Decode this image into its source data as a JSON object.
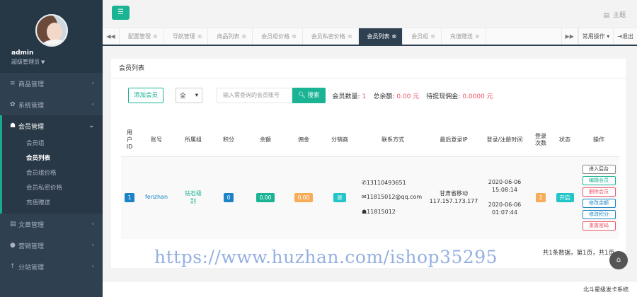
{
  "user": {
    "name": "admin",
    "role": "超级管理员"
  },
  "sidebar": {
    "items": [
      {
        "label": "商品管理",
        "icon": "list-icon"
      },
      {
        "label": "系统管理",
        "icon": "gear-icon"
      },
      {
        "label": "会员管理",
        "icon": "users-icon"
      },
      {
        "label": "文章管理",
        "icon": "file-icon"
      },
      {
        "label": "营销管理",
        "icon": "tag-icon"
      },
      {
        "label": "分站管理",
        "icon": "branch-icon"
      }
    ],
    "member_sub": [
      "会员组",
      "会员列表",
      "会员组价格",
      "会员私密价格",
      "充值赠送"
    ]
  },
  "topbar": {
    "theme_label": "主题"
  },
  "tabs": {
    "items": [
      "配置管理",
      "导航管理",
      "商品列表",
      "会员组价格",
      "会员私密价格",
      "会员列表",
      "会员组",
      "充值赠送"
    ],
    "active": "会员列表",
    "ops_label": "常用操作",
    "logout_label": "退出"
  },
  "panel": {
    "title": "会员列表",
    "add_button": "添加会员",
    "select_value": "全",
    "search_placeholder": "输入需查询的会员账号",
    "search_button": "搜索",
    "stats": {
      "count_label": "会员数量:",
      "count_value": "1",
      "balance_label": "总余额:",
      "balance_value": "0.00 元",
      "commission_label": "待提现佣金:",
      "commission_value": "0.0000 元"
    }
  },
  "table": {
    "headers": {
      "id": [
        "用",
        "户",
        "ID"
      ],
      "account": "账号",
      "group": "所属组",
      "points": "积分",
      "balance": "余额",
      "commission": "佣金",
      "distributor": "分销商",
      "contact": "联系方式",
      "last_ip": "最后登录IP",
      "time": "登录/注册时间",
      "login_count": [
        "登录",
        "次数"
      ],
      "status": "状态",
      "actions": "操作"
    },
    "row": {
      "id": "1",
      "account": "fenzhan",
      "group": [
        "钻石级",
        "别"
      ],
      "points": "0",
      "balance": "0.00",
      "commission": "0.00",
      "distributor": "是",
      "phone": "13110493651",
      "email": "11815012@qq.com",
      "qq": "11815012",
      "ip_location": "甘肃省移动",
      "ip": "117.157.173.177",
      "login_date": "2020-06-06",
      "login_time": "15:08:14",
      "reg_date": "2020-06-06",
      "reg_time": "01:07:44",
      "login_count": "2",
      "status": "开启",
      "ops": [
        "进入后台",
        "编辑会员",
        "删除会员",
        "修改余额",
        "修改积分",
        "重置密码"
      ]
    }
  },
  "pager": {
    "text": "共1条数据，第1页，共1页"
  },
  "watermark": "https://www.huzhan.com/ishop35295",
  "footer": {
    "text": "北斗星级发卡系统"
  },
  "colors": {
    "sidebar": "#2f4050",
    "accent": "#1ab394",
    "danger": "#ed5565",
    "primary": "#1c84c6"
  }
}
